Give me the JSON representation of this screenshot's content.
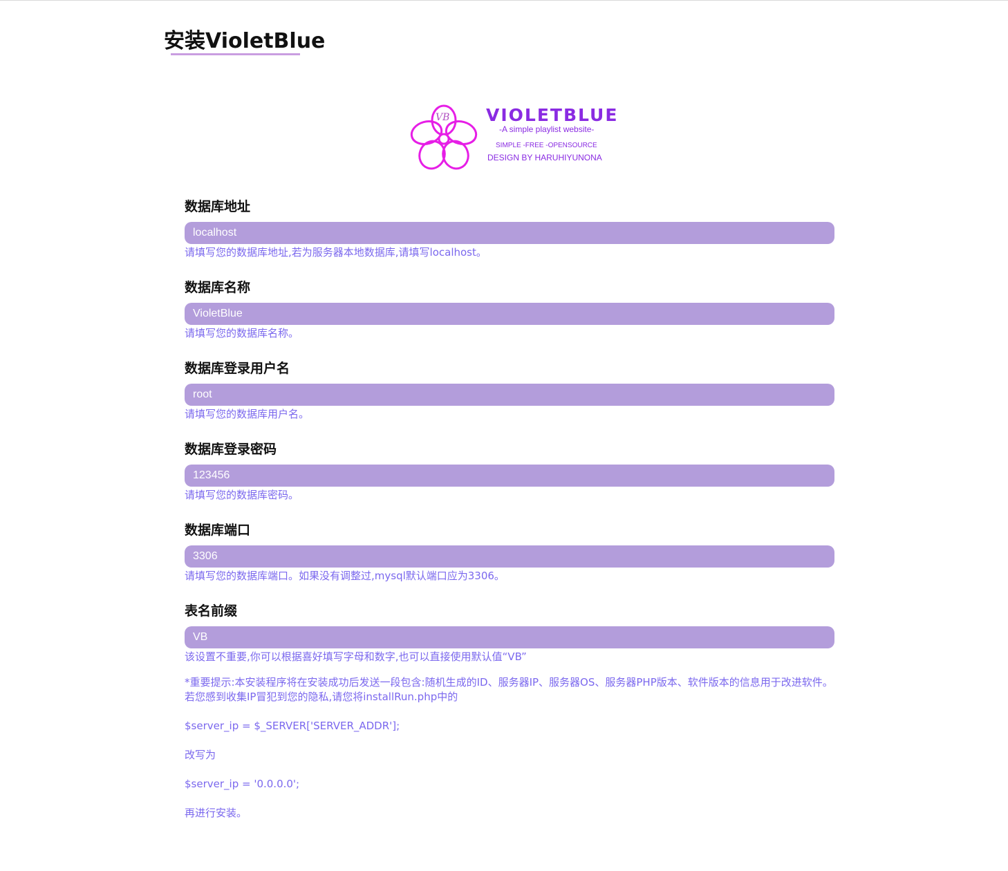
{
  "page": {
    "title": "安装VioletBlue"
  },
  "logo": {
    "name": "VIOLETBLUE",
    "tagline": "-A simple playlist website-",
    "motto": "SIMPLE -FREE -OPENSOURCE",
    "credit": "DESIGN BY HARUHIYUNONA",
    "monogram": "VB",
    "flower_color": "#e61ee6",
    "text_color": "#8a2be2"
  },
  "fields": [
    {
      "label": "数据库地址",
      "value": "localhost",
      "hint": "请填写您的数据库地址,若为服务器本地数据库,请填写localhost。"
    },
    {
      "label": "数据库名称",
      "value": "VioletBlue",
      "hint": "请填写您的数据库名称。"
    },
    {
      "label": "数据库登录用户名",
      "value": "root",
      "hint": "请填写您的数据库用户名。"
    },
    {
      "label": "数据库登录密码",
      "value": "123456",
      "hint": "请填写您的数据库密码。"
    },
    {
      "label": "数据库端口",
      "value": "3306",
      "hint": "请填写您的数据库端口。如果没有调整过,mysql默认端口应为3306。"
    },
    {
      "label": "表名前缀",
      "value": "VB",
      "hint": "该设置不重要,你可以根据喜好填写字母和数字,也可以直接使用默认值“VB”"
    }
  ],
  "notice": {
    "line1": "*重要提示:本安装程序将在安装成功后发送一段包含:随机生成的ID、服务器IP、服务器OS、服务器PHP版本、软件版本的信息用于改进软件。若您感到收集IP冒犯到您的隐私,请您将installRun.php中的",
    "code1": "$server_ip = $_SERVER['SERVER_ADDR'];",
    "line2": "改写为",
    "code2": "$server_ip = '0.0.0.0';",
    "line3": "再进行安装。"
  },
  "colors": {
    "input_bg": "#b39ddb",
    "hint": "#7b68ee",
    "underline": "#c99de0"
  }
}
